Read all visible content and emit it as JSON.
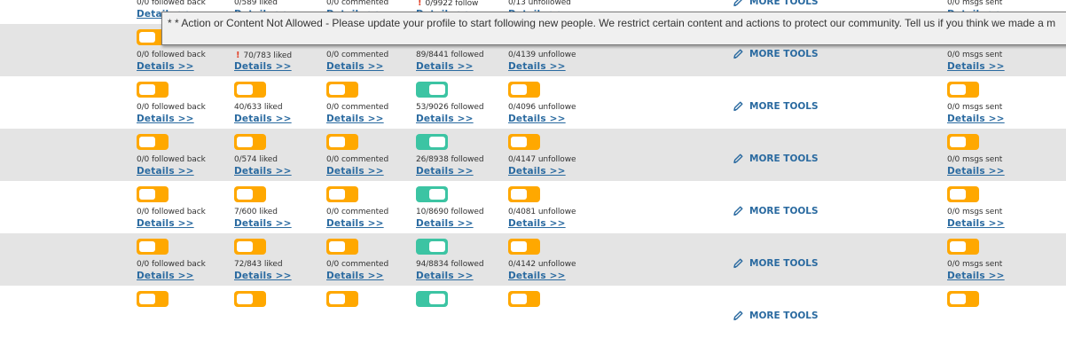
{
  "tooltip": {
    "message": "* * Action or Content Not Allowed - Please update your profile to start following new people. We restrict certain content and actions to protect our community. Tell us if you think we made a m"
  },
  "details_label": "Details >>",
  "more_tools_label": "MORE TOOLS",
  "rows": [
    {
      "followed_back": "0/0 followed back",
      "liked": "0/589 liked",
      "liked_warning": false,
      "commented": "0/0 commented",
      "followed": "0/9922 follow",
      "followed_warning": true,
      "unfollowed": "0/13 unfollowed",
      "msgs": "0/0 msgs sent",
      "toggles": [
        "off",
        "off",
        "off",
        "on",
        "off",
        "off"
      ]
    },
    {
      "followed_back": "0/0 followed back",
      "liked": "70/783 liked",
      "liked_warning": true,
      "commented": "0/0 commented",
      "followed": "89/8441 followed",
      "followed_warning": false,
      "unfollowed": "0/4139 unfollowe",
      "msgs": "0/0 msgs sent",
      "toggles": [
        "off",
        "off",
        "off",
        "on",
        "off",
        "off"
      ]
    },
    {
      "followed_back": "0/0 followed back",
      "liked": "40/633 liked",
      "liked_warning": false,
      "commented": "0/0 commented",
      "followed": "53/9026 followed",
      "followed_warning": false,
      "unfollowed": "0/4096 unfollowe",
      "msgs": "0/0 msgs sent",
      "toggles": [
        "off",
        "off",
        "off",
        "on",
        "off",
        "off"
      ]
    },
    {
      "followed_back": "0/0 followed back",
      "liked": "0/574 liked",
      "liked_warning": false,
      "commented": "0/0 commented",
      "followed": "26/8938 followed",
      "followed_warning": false,
      "unfollowed": "0/4147 unfollowe",
      "msgs": "0/0 msgs sent",
      "toggles": [
        "off",
        "off",
        "off",
        "on",
        "off",
        "off"
      ]
    },
    {
      "followed_back": "0/0 followed back",
      "liked": "7/600 liked",
      "liked_warning": false,
      "commented": "0/0 commented",
      "followed": "10/8690 followed",
      "followed_warning": false,
      "unfollowed": "0/4081 unfollowe",
      "msgs": "0/0 msgs sent",
      "toggles": [
        "off",
        "off",
        "off",
        "on",
        "off",
        "off"
      ]
    },
    {
      "followed_back": "0/0 followed back",
      "liked": "72/843 liked",
      "liked_warning": false,
      "commented": "0/0 commented",
      "followed": "94/8834 followed",
      "followed_warning": false,
      "unfollowed": "0/4142 unfollowe",
      "msgs": "0/0 msgs sent",
      "toggles": [
        "off",
        "off",
        "off",
        "on",
        "off",
        "off"
      ]
    },
    {
      "followed_back": "",
      "liked": "",
      "liked_warning": false,
      "commented": "",
      "followed": "",
      "followed_warning": false,
      "unfollowed": "",
      "msgs": "",
      "toggles": [
        "off",
        "off",
        "off",
        "on",
        "off",
        "off"
      ]
    }
  ],
  "colors": {
    "toggle_off": "#ffa800",
    "toggle_on": "#3cc4a3",
    "link": "#2a6aa0",
    "row_shade": "#e4e4e4",
    "warning": "#e2452d"
  },
  "icons": {
    "more_tools": "pencil-icon",
    "warning": "exclamation-icon"
  }
}
